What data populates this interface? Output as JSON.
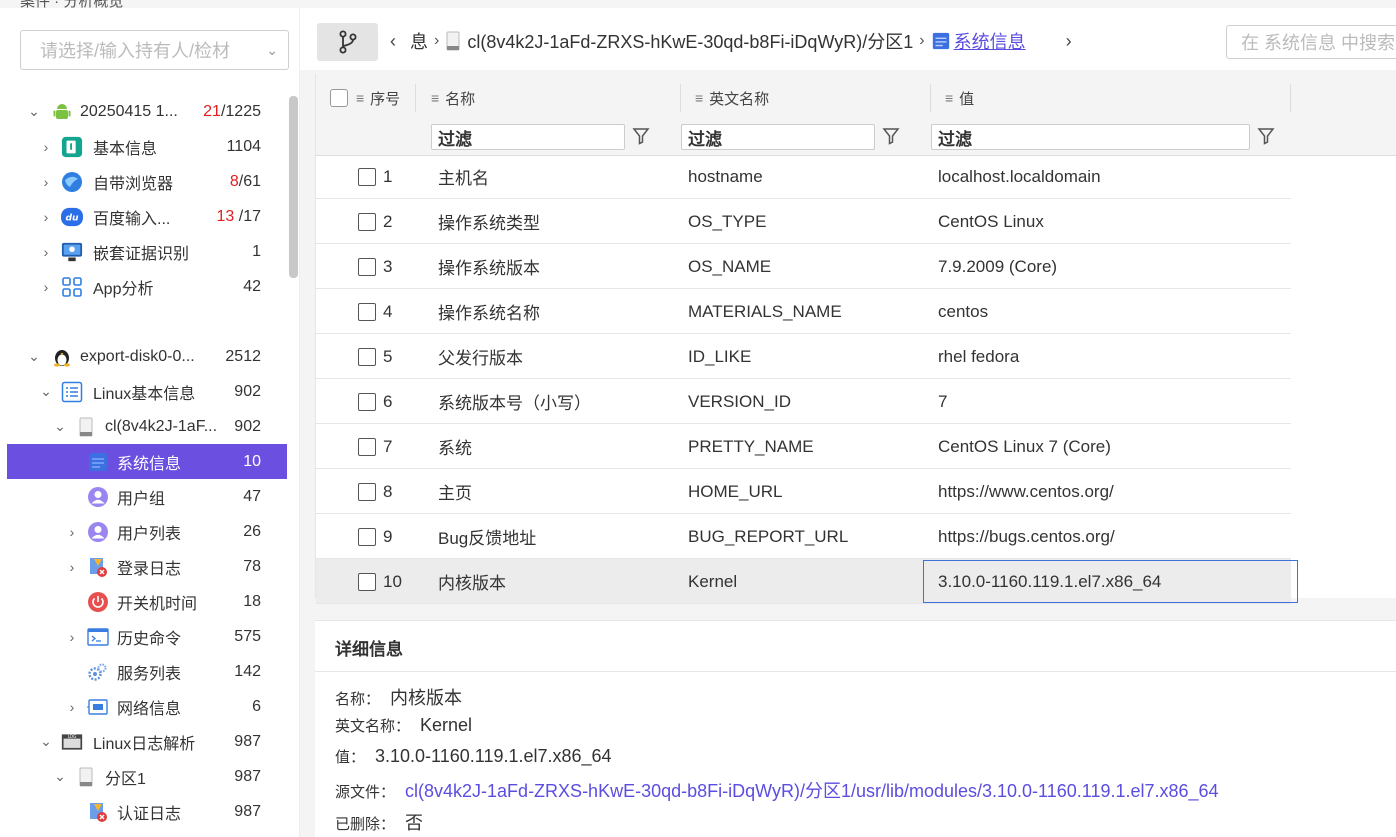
{
  "top_strip": {
    "text": "案件 · 分析概览"
  },
  "sidebar": {
    "owner_placeholder": "请选择/输入持有人/检材",
    "nodes": [
      {
        "label": "20250415 1...",
        "count_red": "21",
        "count": "/1225",
        "icon": "android-icon"
      },
      {
        "label": "基本信息",
        "count": "1104",
        "icon": "info-app-icon"
      },
      {
        "label": "自带浏览器",
        "count_red": "8",
        "count": "/61",
        "icon": "browser-icon"
      },
      {
        "label": "百度输入...",
        "count_red": "13",
        "count": " /17",
        "icon": "baidu-input-icon"
      },
      {
        "label": "嵌套证据识别",
        "count": "1",
        "icon": "nested-evidence-icon"
      },
      {
        "label": "App分析",
        "count": "42",
        "icon": "app-grid-icon"
      },
      {
        "label": "export-disk0-0...",
        "count": "2512",
        "icon": "linux-penguin-icon"
      },
      {
        "label": "Linux基本信息",
        "count": "902",
        "icon": "list-icon"
      },
      {
        "label": "cl(8v4k2J-1aF...",
        "count": "902",
        "icon": "disk-icon"
      },
      {
        "label": "系统信息",
        "count": "10",
        "icon": "system-info-icon"
      },
      {
        "label": "用户组",
        "count": "47",
        "icon": "user-group-icon"
      },
      {
        "label": "用户列表",
        "count": "26",
        "icon": "user-list-icon"
      },
      {
        "label": "登录日志",
        "count": "78",
        "icon": "login-log-icon"
      },
      {
        "label": "开关机时间",
        "count": "18",
        "icon": "power-icon"
      },
      {
        "label": "历史命令",
        "count": "575",
        "icon": "terminal-icon"
      },
      {
        "label": "服务列表",
        "count": "142",
        "icon": "service-gear-icon"
      },
      {
        "label": "网络信息",
        "count": "6",
        "icon": "network-icon"
      },
      {
        "label": "Linux日志解析",
        "count": "987",
        "icon": "log-icon"
      },
      {
        "label": "分区1",
        "count": "987",
        "icon": "disk-icon"
      },
      {
        "label": "认证日志",
        "count": "987",
        "icon": "auth-log-icon"
      }
    ]
  },
  "toolbar": {
    "crumbs": [
      "息",
      "cl(8v4k2J-1aFd-ZRXS-hKwE-30qd-b8Fi-iDqWyR)/分区1",
      "系统信息"
    ],
    "search_placeholder": "在 系统信息 中搜索"
  },
  "grid": {
    "headers": [
      "序号",
      "名称",
      "英文名称",
      "值"
    ],
    "filter_placeholder": "过滤",
    "rows": [
      {
        "no": "1",
        "name": "主机名",
        "en": "hostname",
        "value": "localhost.localdomain"
      },
      {
        "no": "2",
        "name": "操作系统类型",
        "en": "OS_TYPE",
        "value": "CentOS Linux"
      },
      {
        "no": "3",
        "name": "操作系统版本",
        "en": "OS_NAME",
        "value": "7.9.2009 (Core)"
      },
      {
        "no": "4",
        "name": "操作系统名称",
        "en": "MATERIALS_NAME",
        "value": "centos"
      },
      {
        "no": "5",
        "name": "父发行版本",
        "en": "ID_LIKE",
        "value": "rhel fedora"
      },
      {
        "no": "6",
        "name": "系统版本号（小写）",
        "en": "VERSION_ID",
        "value": "7"
      },
      {
        "no": "7",
        "name": "系统",
        "en": "PRETTY_NAME",
        "value": "CentOS Linux 7 (Core)"
      },
      {
        "no": "8",
        "name": "主页",
        "en": "HOME_URL",
        "value": "https://www.centos.org/"
      },
      {
        "no": "9",
        "name": "Bug反馈地址",
        "en": "BUG_REPORT_URL",
        "value": "https://bugs.centos.org/"
      },
      {
        "no": "10",
        "name": "内核版本",
        "en": "Kernel",
        "value": "3.10.0-1160.119.1.el7.x86_64"
      }
    ]
  },
  "detail": {
    "title": "详细信息",
    "name_key": "名称：",
    "name_val": "内核版本",
    "en_key": "英文名称：",
    "en_val": "Kernel",
    "value_key": "值：",
    "value_val": "3.10.0-1160.119.1.el7.x86_64",
    "src_key": "源文件：",
    "src_val": "cl(8v4k2J-1aFd-ZRXS-hKwE-30qd-b8Fi-iDqWyR)/分区1/usr/lib/modules/3.10.0-1160.119.1.el7.x86_64",
    "del_key": "已删除：",
    "del_val": "否"
  },
  "colors": {
    "accent": "#6b4fe0",
    "link": "#5b4de0",
    "alert": "#e02020"
  }
}
